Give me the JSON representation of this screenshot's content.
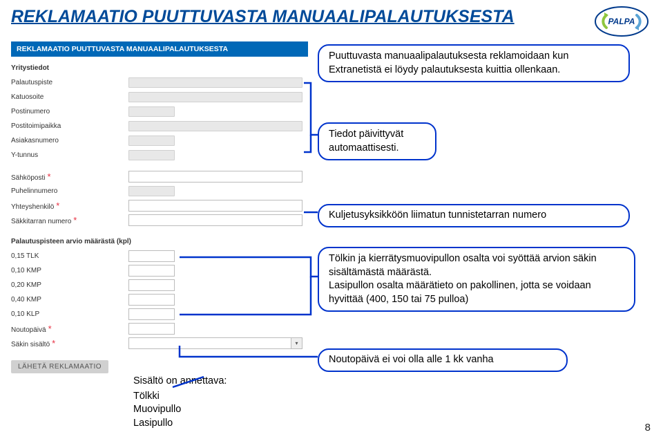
{
  "title": "REKLAMAATIO PUUTTUVASTA MANUAALIPALAUTUKSESTA",
  "logo_text": "PALPA",
  "form_header": "REKLAMAATIO PUUTTUVASTA MANUAALIPALAUTUKSESTA",
  "section1": "Yritystiedot",
  "labels": {
    "palautuspiste": "Palautuspiste",
    "katuosoite": "Katuosoite",
    "postinumero": "Postinumero",
    "postitoimipaikka": "Postitoimipaikka",
    "asiakasnumero": "Asiakasnumero",
    "ytunnus": "Y-tunnus",
    "sahkoposti": "Sähköposti",
    "puhelinnumero": "Puhelinnumero",
    "yhteyshenkilo": "Yhteyshenkilö",
    "sakkitarra": "Säkkitarran numero",
    "noutopaiva": "Noutopäivä",
    "sakin_sisalto": "Säkin sisältö"
  },
  "section2": "Palautuspisteen arvio määrästä (kpl)",
  "qty": {
    "tlk015": "0,15 TLK",
    "kmp010": "0,10 KMP",
    "kmp020": "0,20 KMP",
    "kmp040": "0,40 KMP",
    "klp010": "0,10 KLP"
  },
  "send_button": "LÄHETÄ REKLAMAATIO",
  "callouts": {
    "c1": "Puuttuvasta manuaalipalautuksesta reklamoidaan kun Extranetistä ei löydy palautuksesta kuittia ollenkaan.",
    "c2": "Tiedot päivittyvät automaattisesti.",
    "c3": "Kuljetusyksikköön liimatun tunnistetarran numero",
    "c4a": "Tölkin ja kierrätysmuovipullon osalta voi syöttää arvion säkin sisältämästä määrästä.",
    "c4b": "Lasipullon osalta määrätieto on pakollinen, jotta se voidaan hyvittää (400, 150 tai 75 pulloa)",
    "c5": "Noutopäivä ei voi olla alle 1 kk vanha"
  },
  "annot6": {
    "header": "Sisältö on annettava:",
    "l1": "Tölkki",
    "l2": "Muovipullo",
    "l3": "Lasipullo"
  },
  "page_number": "8"
}
